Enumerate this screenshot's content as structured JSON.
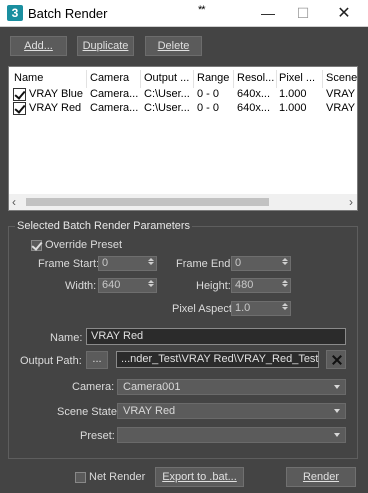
{
  "window": {
    "title": "Batch Render",
    "marker": "**",
    "app_icon": "3",
    "min_glyph": "—",
    "max_glyph": "☐",
    "close_glyph": "✕"
  },
  "toolbar": {
    "add_label": "Add...",
    "duplicate_label": "Duplicate",
    "delete_label": "Delete"
  },
  "list": {
    "columns": [
      "Name",
      "Camera",
      "Output ...",
      "Range",
      "Resol...",
      "Pixel ...",
      "Scene S"
    ],
    "rows": [
      {
        "checked": true,
        "cells": [
          "VRAY Blue",
          "Camera...",
          "C:\\User...",
          "0 - 0",
          "640x...",
          "1.000",
          "VRAY I"
        ]
      },
      {
        "checked": true,
        "cells": [
          "VRAY Red",
          "Camera...",
          "C:\\User...",
          "0 - 0",
          "640x...",
          "1.000",
          "VRAY I"
        ]
      }
    ],
    "scroll_left": "‹",
    "scroll_right": "›"
  },
  "params": {
    "group_title": "Selected Batch Render Parameters",
    "override_preset_label": "Override Preset",
    "override_preset_checked": true,
    "frame_start_label": "Frame Start:",
    "frame_start_value": "0",
    "frame_end_label": "Frame End:",
    "frame_end_value": "0",
    "width_label": "Width:",
    "width_value": "640",
    "height_label": "Height:",
    "height_value": "480",
    "pixel_aspect_label": "Pixel Aspect:",
    "pixel_aspect_value": "1.0",
    "name_label": "Name:",
    "name_value": "VRAY Red",
    "output_path_label": "Output Path:",
    "browse_label": "...",
    "output_path_value": "...nder_Test\\VRAY Red\\VRAY_Red_Test.exr",
    "camera_label": "Camera:",
    "camera_value": "Camera001",
    "scene_state_label": "Scene State:",
    "scene_state_value": "VRAY Red",
    "preset_label": "Preset:",
    "preset_value": ""
  },
  "footer": {
    "net_render_label": "Net Render",
    "net_render_checked": false,
    "export_label": "Export to .bat...",
    "render_label": "Render"
  }
}
